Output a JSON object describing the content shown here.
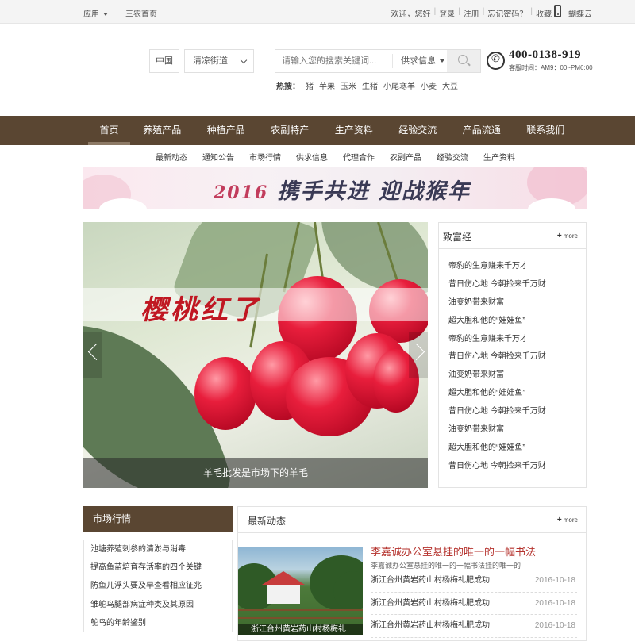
{
  "topbar": {
    "app_label": "应用",
    "home_link": "三农首页",
    "welcome": "欢迎，您好",
    "sep": "|",
    "login": "登录",
    "register": "注册",
    "forgot": "忘记密码？",
    "favorite": "收藏",
    "brand_link": "蝴蝶云"
  },
  "header": {
    "country": "中国",
    "street": "清凉街道",
    "search_placeholder": "请输入您的搜索关键词...",
    "search_type": "供求信息",
    "hot_label": "热搜：",
    "hot_terms": [
      "猪",
      "苹果",
      "玉米",
      "生猪",
      "小尾寒羊",
      "小麦",
      "大豆"
    ],
    "phone": "400-0138-919",
    "hours": "客服时间：AM9：00~PM6:00"
  },
  "nav": {
    "items": [
      "首页",
      "养殖产品",
      "种植产品",
      "农副特产",
      "生产资料",
      "经验交流",
      "产品流通",
      "联系我们"
    ],
    "active_index": 0,
    "sub_items": [
      "最新动态",
      "通知公告",
      "市场行情",
      "供求信息",
      "代理合作",
      "农副产品",
      "经验交流",
      "生产资料"
    ]
  },
  "banner": {
    "year": "2016",
    "slogan": "携手共进 迎战猴年"
  },
  "slider": {
    "title": "樱桃红了",
    "caption": "羊毛批发是市场下的羊毛"
  },
  "fortune": {
    "title": "致富经",
    "more": "more",
    "items": [
      "帝豹的生意赚来千万才",
      "昔日伤心地 今朝捡来千万财",
      "油变奶带来财富",
      "超大胆和他的“娃娃鱼”",
      "帝豹的生意赚来千万才",
      "昔日伤心地 今朝捡来千万财",
      "油变奶带来财富",
      "超大胆和他的“娃娃鱼”",
      "昔日伤心地 今朝捡来千万财",
      "油变奶带来财富",
      "超大胆和他的“娃娃鱼”",
      "昔日伤心地 今朝捡来千万财"
    ]
  },
  "market": {
    "title": "市场行情",
    "items": [
      "池塘养殖刺参的清淤与消毒",
      "提高鱼苗培育存活率的四个关键",
      "防鱼儿浮头要及早查看相应征兆",
      "雏鸵鸟腿部病症种类及其原因",
      "鸵鸟的年龄鉴别"
    ]
  },
  "latest": {
    "title": "最新动态",
    "more": "more",
    "photo_caption": "浙江台州黄岩药山村杨梅礼",
    "headline": "李嘉诚办公室悬挂的唯一的一幅书法",
    "summary": "李嘉诚办公室悬挂的唯一的一幅书法挂的唯一的",
    "items": [
      {
        "title": "浙江台州黄岩药山村杨梅礼肥成功",
        "date": "2016-10-18"
      },
      {
        "title": "浙江台州黄岩药山村杨梅礼肥成功",
        "date": "2016-10-18"
      },
      {
        "title": "浙江台州黄岩药山村杨梅礼肥成功",
        "date": "2016-10-18"
      }
    ]
  }
}
